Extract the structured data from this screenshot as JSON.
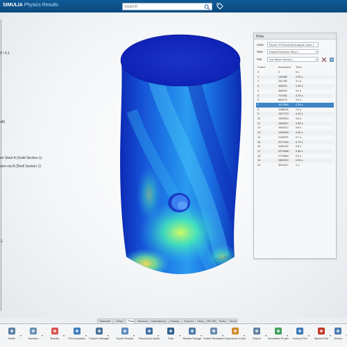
{
  "app": {
    "brand": "SIMULIA",
    "product": "Physics Results"
  },
  "search": {
    "placeholder": "Search"
  },
  "tree": {
    "items": [
      {
        "label": "0 / 6.1"
      },
      {
        "label": "ult)"
      },
      {
        "label": "en Steel A (Solid Section.1)"
      },
      {
        "label": "ram-via A (Shell Section.1)"
      },
      {
        "label": ".1"
      }
    ]
  },
  "plots": {
    "title": "Plots",
    "case_label": "Case",
    "case_value": "Result Of Structural Analysis Case.1",
    "step_label": "Step",
    "step_value": "Explicit Dynamic Step.1",
    "plot_label": "Plot",
    "plot_value": "Von Mises Stress.1",
    "col_frame": "Frame",
    "col_increment": "Increment",
    "col_time": "Time",
    "rows": [
      {
        "frame": "0",
        "increment": "0",
        "time": "0 s"
      },
      {
        "frame": "1",
        "increment": "130985",
        "time": "0.05 s"
      },
      {
        "frame": "2",
        "increment": "261785",
        "time": "0.1 s"
      },
      {
        "frame": "3",
        "increment": "408076",
        "time": "0.15 s"
      },
      {
        "frame": "4",
        "increment": "546329",
        "time": "0.2 s"
      },
      {
        "frame": "5",
        "increment": "701054",
        "time": "0.25 s"
      },
      {
        "frame": "6",
        "increment": "864179",
        "time": "0.3 s"
      },
      {
        "frame": "7",
        "increment": "1023566",
        "time": "0.35 s"
      },
      {
        "frame": "8",
        "increment": "1186618",
        "time": "0.4 s"
      },
      {
        "frame": "9",
        "increment": "1347710",
        "time": "0.45 s"
      },
      {
        "frame": "10",
        "increment": "1500504",
        "time": "0.5 s"
      },
      {
        "frame": "11",
        "increment": "1648627",
        "time": "0.55 s"
      },
      {
        "frame": "12",
        "increment": "1815017",
        "time": "0.6 s"
      },
      {
        "frame": "13",
        "increment": "1965028",
        "time": "0.65 s"
      },
      {
        "frame": "14",
        "increment": "2130971",
        "time": "0.7 s"
      },
      {
        "frame": "15",
        "increment": "2271344",
        "time": "0.75 s"
      },
      {
        "frame": "16",
        "increment": "2430119",
        "time": "0.8 s"
      },
      {
        "frame": "17",
        "increment": "2574888",
        "time": "0.85 s"
      },
      {
        "frame": "18",
        "increment": "2719800",
        "time": "0.9 s"
      },
      {
        "frame": "19",
        "increment": "2863519",
        "time": "0.95 s"
      },
      {
        "frame": "20",
        "increment": "3011417",
        "time": "1 s"
      }
    ],
    "selected_index": 7
  },
  "tabs": [
    {
      "label": "Standard"
    },
    {
      "label": "Setup"
    },
    {
      "label": "Plots"
    },
    {
      "label": "Sensors"
    },
    {
      "label": "Calculations"
    },
    {
      "label": "Display"
    },
    {
      "label": "Explore"
    },
    {
      "label": "View"
    },
    {
      "label": "AR-VR"
    },
    {
      "label": "Tools"
    },
    {
      "label": "Touch"
    }
  ],
  "active_tab": 2,
  "toolbar": [
    {
      "label": "Model",
      "icon": "model-icon",
      "color": "#5b7fa6"
    },
    {
      "label": "Scenario",
      "icon": "scenario-icon",
      "color": "#6a8fb5"
    },
    {
      "label": "Results",
      "icon": "results-icon",
      "color": "#d9534f"
    },
    {
      "label": "Plot Animation",
      "icon": "animation-icon",
      "color": "#3a7ec2"
    },
    {
      "label": "Feature Manager",
      "icon": "feature-icon",
      "color": "#4a6f95"
    },
    {
      "label": "Export Results",
      "icon": "export-icon",
      "color": "#5a8bbf"
    },
    {
      "label": "Result Axis System",
      "icon": "axis-icon",
      "color": "#3c6ea5"
    },
    {
      "label": "Path",
      "icon": "path-icon",
      "color": "#2f5f8f"
    },
    {
      "label": "Results Storage",
      "icon": "storage-icon",
      "color": "#4d7aa8"
    },
    {
      "label": "Delete Simulation R.",
      "icon": "delete-icon",
      "color": "#6b8db0"
    },
    {
      "label": "Experience Content",
      "icon": "experience-icon",
      "color": "#d08a2a"
    },
    {
      "label": "Report",
      "icon": "report-icon",
      "color": "#5f7f9f"
    },
    {
      "label": "Simulation Properties",
      "icon": "properties-icon",
      "color": "#3f9e5a"
    },
    {
      "label": "Contour Plot",
      "icon": "contour-icon",
      "color": "#3a78b8"
    },
    {
      "label": "Symbol Plot",
      "icon": "symbol-icon",
      "color": "#c0392b"
    },
    {
      "label": "Sensor",
      "icon": "sensor-icon",
      "color": "#4a7ab0"
    }
  ]
}
